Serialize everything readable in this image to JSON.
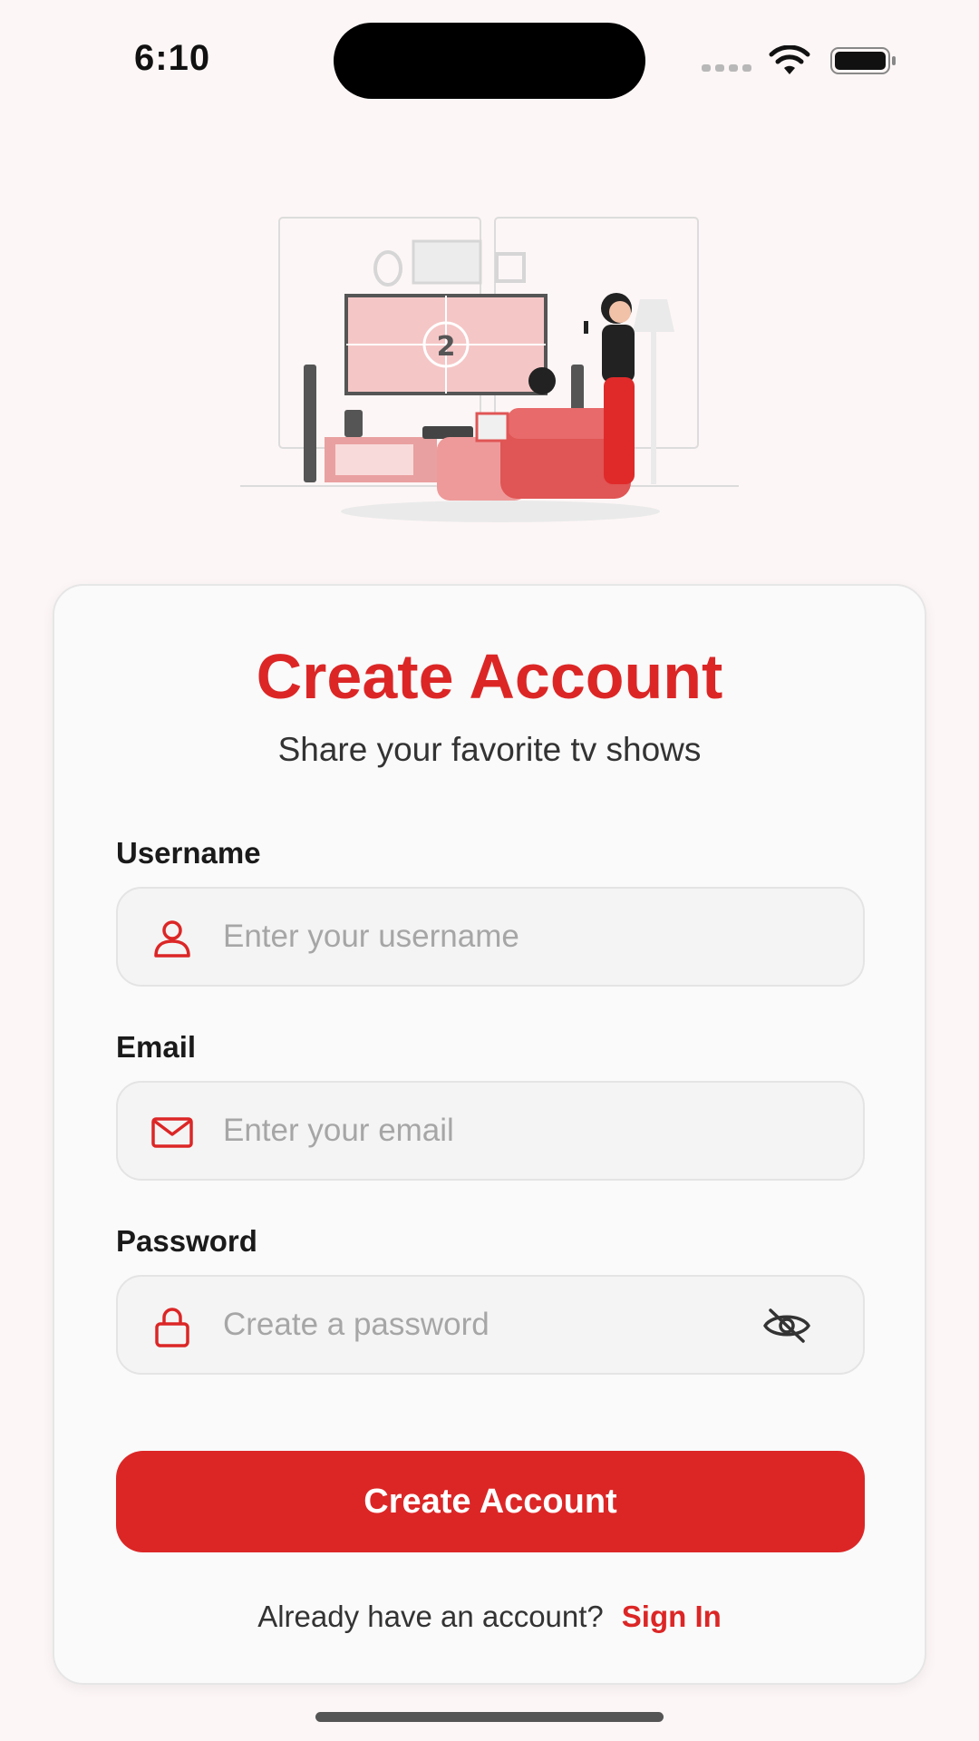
{
  "status_bar": {
    "time": "6:10",
    "icons": [
      "signal-icon",
      "wifi-icon",
      "battery-icon"
    ]
  },
  "illustration": {
    "icon": "couple-watching-tv-illustration",
    "screen_number": "2"
  },
  "card": {
    "title": "Create Account",
    "subtitle": "Share your favorite tv shows"
  },
  "form": {
    "username": {
      "label": "Username",
      "placeholder": "Enter your username",
      "value": "",
      "icon": "user-icon"
    },
    "email": {
      "label": "Email",
      "placeholder": "Enter your email",
      "value": "",
      "icon": "mail-icon"
    },
    "password": {
      "label": "Password",
      "placeholder": "Create a password",
      "value": "",
      "icon": "lock-icon",
      "toggle_icon": "eye-off-icon"
    }
  },
  "actions": {
    "submit_label": "Create Account",
    "footer_text": "Already have an account?",
    "sign_in_label": "Sign In"
  },
  "colors": {
    "accent": "#dc2626",
    "background": "#fdf6f6",
    "card": "#fafafa",
    "input_bg": "#f4f4f4",
    "placeholder": "#a6a6a6"
  }
}
